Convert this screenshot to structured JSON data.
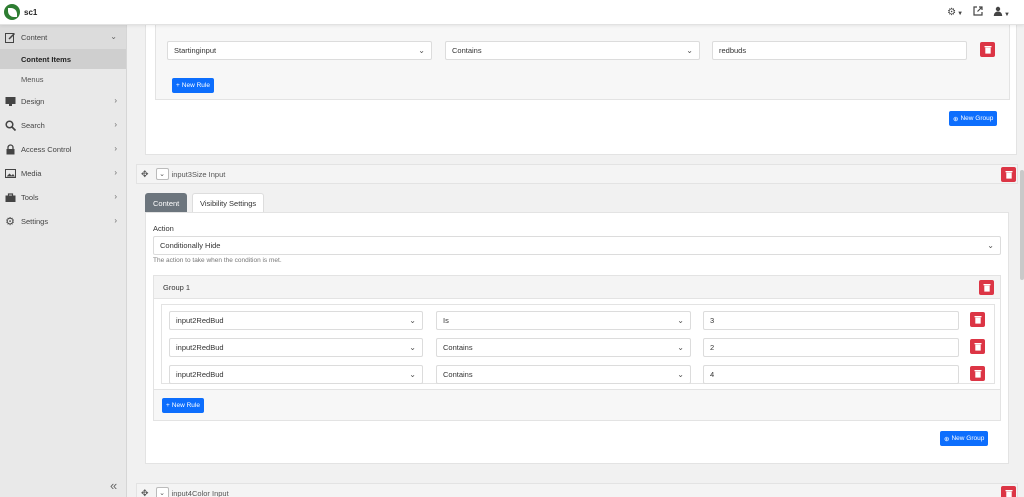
{
  "topbar": {
    "site_name": "sc1"
  },
  "sidebar": {
    "content": "Content",
    "content_items": "Content Items",
    "menus": "Menus",
    "design": "Design",
    "search": "Search",
    "access_control": "Access Control",
    "media": "Media",
    "tools": "Tools",
    "settings": "Settings"
  },
  "top_group": {
    "rule": {
      "field": "Startinginput",
      "operator": "Contains",
      "value": "redbuds"
    },
    "new_rule": "New Rule",
    "new_group": "New Group"
  },
  "field_input3": {
    "title": "input3Size Input",
    "tabs": [
      "Content",
      "Visibility Settings"
    ],
    "action_label": "Action",
    "action_value": "Conditionally Hide",
    "action_help": "The action to take when the condition is met.",
    "group_title": "Group 1",
    "rules": [
      {
        "field": "input2RedBud",
        "operator": "Is",
        "value": "3"
      },
      {
        "field": "input2RedBud",
        "operator": "Contains",
        "value": "2"
      },
      {
        "field": "input2RedBud",
        "operator": "Contains",
        "value": "4"
      }
    ],
    "new_rule": "New Rule",
    "new_group": "New Group"
  },
  "field_input4": {
    "title": "input4Color Input"
  }
}
